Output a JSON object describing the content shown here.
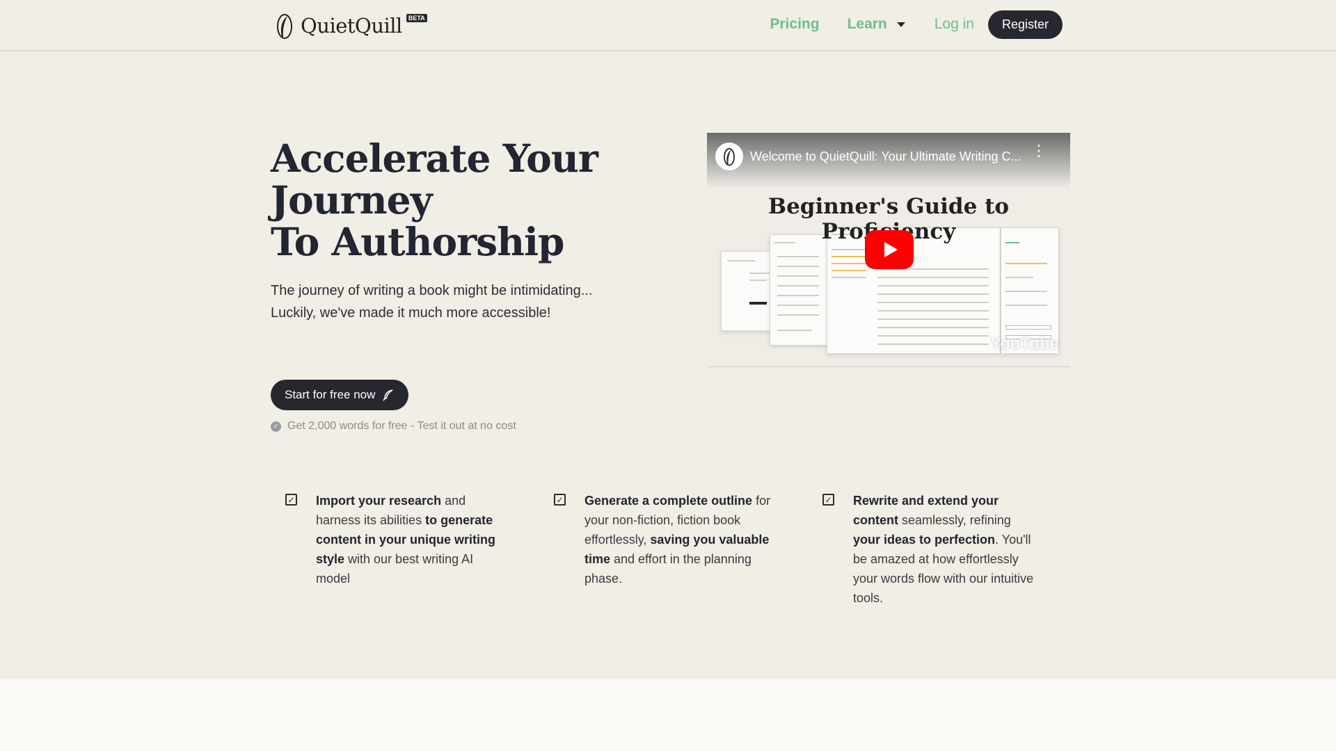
{
  "header": {
    "logo_text": "QuietQuill",
    "beta_badge": "BETA",
    "nav": {
      "pricing": "Pricing",
      "learn": "Learn",
      "login": "Log in",
      "register": "Register"
    }
  },
  "hero": {
    "title_line1": "Accelerate Your Journey",
    "title_line2": "To Authorship",
    "subtitle_line1": "The journey of writing a book might be intimidating...",
    "subtitle_line2": "Luckily, we've made it much more accessible!",
    "cta_label": "Start for free now",
    "free_note": "Get 2,000 words for free - Test it out at no cost"
  },
  "video": {
    "title": "Welcome to QuietQuill: Your Ultimate Writing C...",
    "heading": "Beginner's Guide to Proficiency",
    "watermark": "YouTube"
  },
  "features": [
    {
      "parts": [
        {
          "b": true,
          "t": "Import your research"
        },
        {
          "b": false,
          "t": " and harness its abilities "
        },
        {
          "b": true,
          "t": "to generate content in your unique writing style"
        },
        {
          "b": false,
          "t": " with our best writing AI model"
        }
      ]
    },
    {
      "parts": [
        {
          "b": true,
          "t": "Generate a complete outline"
        },
        {
          "b": false,
          "t": " for your non-fiction, fiction book effortlessly, "
        },
        {
          "b": true,
          "t": "saving you valuable time"
        },
        {
          "b": false,
          "t": " and effort in the planning phase."
        }
      ]
    },
    {
      "parts": [
        {
          "b": true,
          "t": "Rewrite and extend your content"
        },
        {
          "b": false,
          "t": " seamlessly, refining "
        },
        {
          "b": true,
          "t": "your ideas to perfection"
        },
        {
          "b": false,
          "t": ". You'll be amazed at how effortlessly your words flow with our intuitive tools."
        }
      ]
    }
  ],
  "colors": {
    "accent_green": "#6cbf8f",
    "dark": "#27282f",
    "background": "#f0eee5",
    "youtube_red": "#ff0000"
  }
}
